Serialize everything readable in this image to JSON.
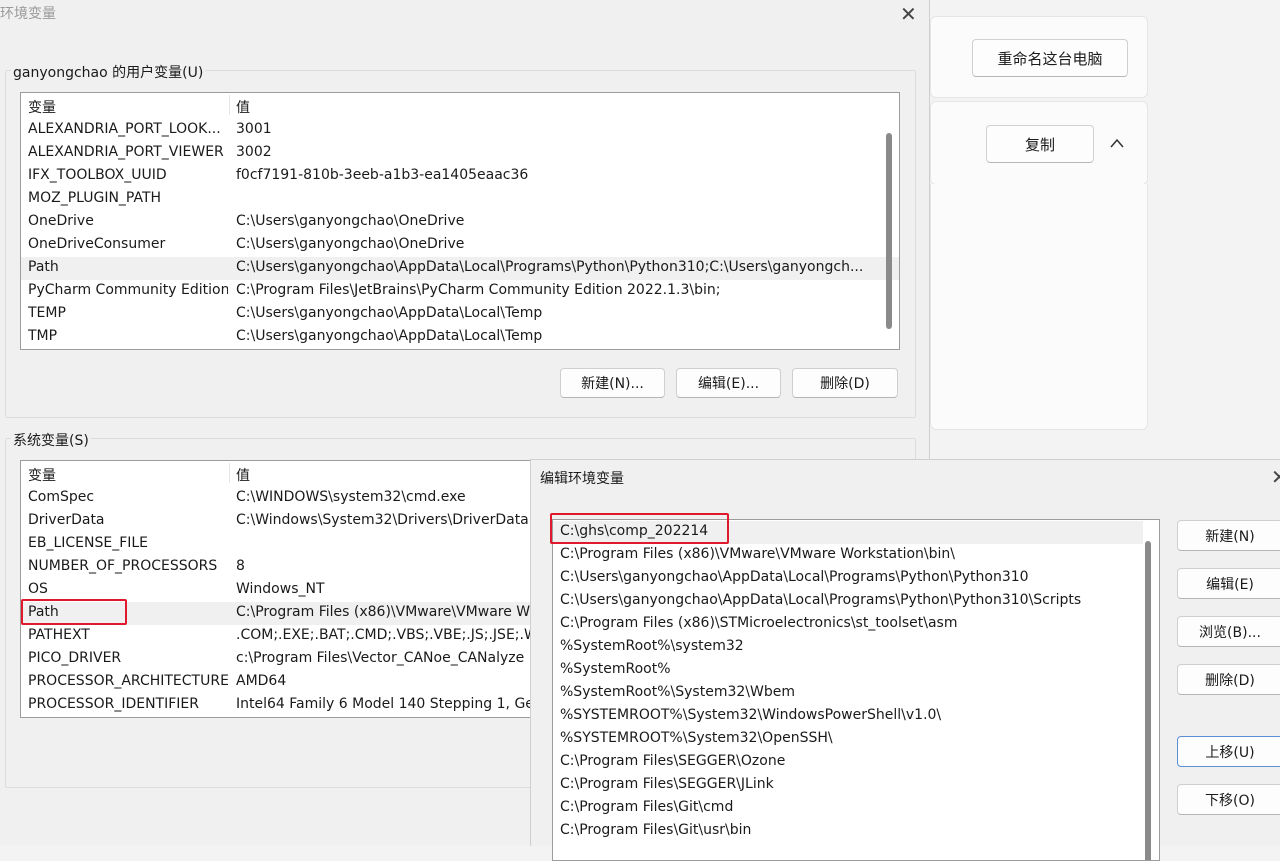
{
  "background_app": {
    "rename_button": "重命名这台电脑",
    "copy_button": "复制"
  },
  "env_dialog": {
    "title": "环境变量",
    "user_group": {
      "label": "ganyongchao 的用户变量(U)",
      "header_var": "变量",
      "header_val": "值",
      "rows": [
        {
          "name": "ALEXANDRIA_PORT_LOOK...",
          "value": "3001"
        },
        {
          "name": "ALEXANDRIA_PORT_VIEWER",
          "value": "3002"
        },
        {
          "name": "IFX_TOOLBOX_UUID",
          "value": "f0cf7191-810b-3eeb-a1b3-ea1405eaac36"
        },
        {
          "name": "MOZ_PLUGIN_PATH",
          "value": ""
        },
        {
          "name": "OneDrive",
          "value": "C:\\Users\\ganyongchao\\OneDrive"
        },
        {
          "name": "OneDriveConsumer",
          "value": "C:\\Users\\ganyongchao\\OneDrive"
        },
        {
          "name": "Path",
          "value": "C:\\Users\\ganyongchao\\AppData\\Local\\Programs\\Python\\Python310;C:\\Users\\ganyongch..."
        },
        {
          "name": "PyCharm Community Edition",
          "value": "C:\\Program Files\\JetBrains\\PyCharm Community Edition 2022.1.3\\bin;"
        },
        {
          "name": "TEMP",
          "value": "C:\\Users\\ganyongchao\\AppData\\Local\\Temp"
        },
        {
          "name": "TMP",
          "value": "C:\\Users\\ganyongchao\\AppData\\Local\\Temp"
        }
      ],
      "new_button": "新建(N)...",
      "edit_button": "编辑(E)...",
      "delete_button": "删除(D)"
    },
    "system_group": {
      "label": "系统变量(S)",
      "header_var": "变量",
      "header_val": "值",
      "rows": [
        {
          "name": "ComSpec",
          "value": "C:\\WINDOWS\\system32\\cmd.exe"
        },
        {
          "name": "DriverData",
          "value": "C:\\Windows\\System32\\Drivers\\DriverData"
        },
        {
          "name": "EB_LICENSE_FILE",
          "value": ""
        },
        {
          "name": "NUMBER_OF_PROCESSORS",
          "value": "8"
        },
        {
          "name": "OS",
          "value": "Windows_NT"
        },
        {
          "name": "Path",
          "value": "C:\\Program Files (x86)\\VMware\\VMware W"
        },
        {
          "name": "PATHEXT",
          "value": ".COM;.EXE;.BAT;.CMD;.VBS;.VBE;.JS;.JSE;.WS"
        },
        {
          "name": "PICO_DRIVER",
          "value": "c:\\Program Files\\Vector_CANoe_CANalyze"
        },
        {
          "name": "PROCESSOR_ARCHITECTURE",
          "value": "AMD64"
        },
        {
          "name": "PROCESSOR_IDENTIFIER",
          "value": "Intel64 Family 6 Model 140 Stepping 1, Ge"
        }
      ]
    }
  },
  "edit_dialog": {
    "title": "编辑环境变量",
    "paths": [
      "C:\\ghs\\comp_202214",
      "C:\\Program Files (x86)\\VMware\\VMware Workstation\\bin\\",
      "C:\\Users\\ganyongchao\\AppData\\Local\\Programs\\Python\\Python310",
      "C:\\Users\\ganyongchao\\AppData\\Local\\Programs\\Python\\Python310\\Scripts",
      "C:\\Program Files (x86)\\STMicroelectronics\\st_toolset\\asm",
      "%SystemRoot%\\system32",
      "%SystemRoot%",
      "%SystemRoot%\\System32\\Wbem",
      "%SYSTEMROOT%\\System32\\WindowsPowerShell\\v1.0\\",
      "%SYSTEMROOT%\\System32\\OpenSSH\\",
      "C:\\Program Files\\SEGGER\\Ozone",
      "C:\\Program Files\\SEGGER\\JLink",
      "C:\\Program Files\\Git\\cmd",
      "C:\\Program Files\\Git\\usr\\bin"
    ],
    "new_button": "新建(N)",
    "edit_button": "编辑(E)",
    "browse_button": "浏览(B)...",
    "delete_button": "删除(D)",
    "move_up_button": "上移(U)",
    "move_down_button": "下移(O)"
  },
  "icons": {
    "close": "close-icon",
    "chevron_up": "chevron-up-icon"
  },
  "colors": {
    "highlight_red": "#e0192d",
    "selected_row": "#f0f0f0"
  }
}
